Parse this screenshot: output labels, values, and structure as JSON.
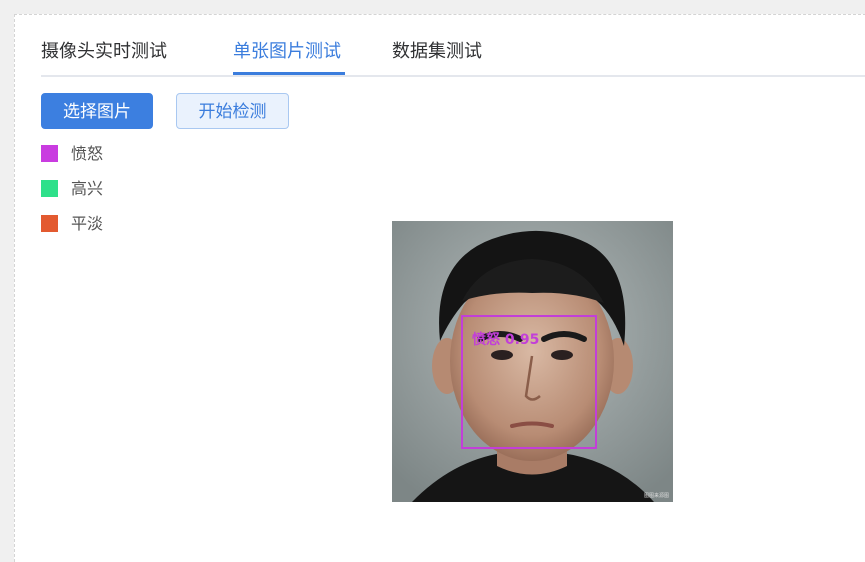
{
  "tabs": [
    {
      "label": "摄像头实时测试",
      "active": false
    },
    {
      "label": "单张图片测试",
      "active": true
    },
    {
      "label": "数据集测试",
      "active": false
    }
  ],
  "buttons": {
    "select_image": "选择图片",
    "start_detect": "开始检测"
  },
  "legend": [
    {
      "label": "愤怒",
      "color": "#c93ce0"
    },
    {
      "label": "高兴",
      "color": "#2ee08a"
    },
    {
      "label": "平淡",
      "color": "#e35a30"
    }
  ],
  "detection": {
    "label": "愤怒 0.95",
    "box_color": "#c23fd8"
  },
  "image": {
    "watermark": "图图来源图"
  },
  "colors": {
    "accent": "#3b7ddd",
    "primary_button": "#3c7fe0"
  }
}
